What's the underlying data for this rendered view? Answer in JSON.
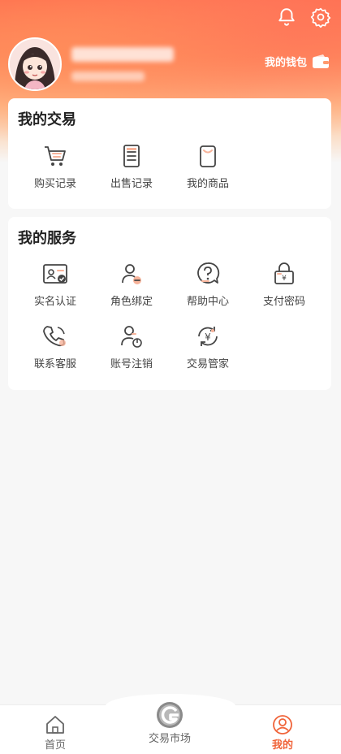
{
  "header": {
    "wallet_label": "我的钱包"
  },
  "trade_card": {
    "title": "我的交易",
    "items": [
      {
        "label": "购买记录",
        "icon": "cart-icon"
      },
      {
        "label": "出售记录",
        "icon": "receipt-icon"
      },
      {
        "label": "我的商品",
        "icon": "product-icon"
      }
    ]
  },
  "service_card": {
    "title": "我的服务",
    "items": [
      {
        "label": "实名认证",
        "icon": "id-card-icon"
      },
      {
        "label": "角色绑定",
        "icon": "user-link-icon"
      },
      {
        "label": "帮助中心",
        "icon": "help-icon"
      },
      {
        "label": "支付密码",
        "icon": "payment-lock-icon"
      },
      {
        "label": "联系客服",
        "icon": "phone-icon"
      },
      {
        "label": "账号注销",
        "icon": "user-power-icon"
      },
      {
        "label": "交易管家",
        "icon": "yuan-cycle-icon"
      }
    ]
  },
  "bottom_nav": {
    "items": [
      {
        "label": "首页",
        "icon": "home-icon"
      },
      {
        "label": "交易市场",
        "icon": "market-logo-icon"
      },
      {
        "label": "我的",
        "icon": "profile-icon"
      }
    ],
    "active_index": 2
  },
  "colors": {
    "accent": "#f0643a",
    "header_top": "#ff6a4d",
    "icon_highlight": "#f7b39a"
  }
}
